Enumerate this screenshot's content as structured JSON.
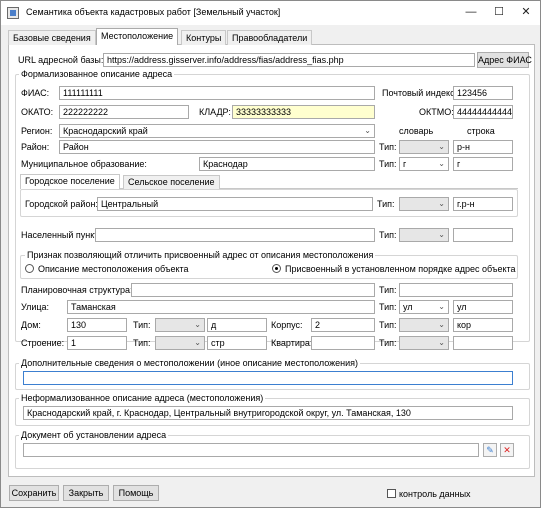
{
  "window": {
    "title": "Семантика объекта кадастровых работ [Земельный участок]",
    "minimize_glyph": "—",
    "maximize_glyph": "☐",
    "close_glyph": "✕"
  },
  "tabs": [
    "Базовые сведения",
    "Местоположение",
    "Контуры",
    "Правообладатели"
  ],
  "url": {
    "label": "URL адресной базы:",
    "value": "https://address.gisserver.info/address/fias/address_fias.php",
    "button": "Адрес ФИАС"
  },
  "formal": {
    "title": "Формализованное описание адреса",
    "fias_label": "ФИАС:",
    "fias": "111111111",
    "postal_label": "Почтовый индекс:",
    "postal": "123456",
    "okato_label": "ОКАТО:",
    "okato": "222222222",
    "kladr_label": "КЛАДР:",
    "kladr": "33333333333",
    "oktmo_label": "ОКТМО:",
    "oktmo": "44444444444",
    "region_label": "Регион:",
    "region": "Краснодарский край",
    "dict_header": "словарь",
    "str_header": "строка",
    "district_label": "Район:",
    "district": "Район",
    "type_label": "Тип:",
    "district_type_str": "р-н",
    "muni_label": "Муниципальное образование:",
    "muni": "Краснодар",
    "muni_type_combo": "г",
    "muni_type_str": "г",
    "subtabs": [
      "Городское поселение",
      "Сельское поселение"
    ],
    "city_district_label": "Городской район:",
    "city_district": "Центральный",
    "city_district_type_str": "г.р-н",
    "locality_label": "Населенный пункт:"
  },
  "sign": {
    "title": "Признак позволяющий отличить присвоенный адрес от описания местоположения",
    "option1": "Описание местоположения объекта",
    "option2": "Присвоенный в установленном порядке адрес объекта"
  },
  "street": {
    "plan_label": "Планировочная структура:",
    "street_label": "Улица:",
    "street": "Таманская",
    "street_type_combo": "ул",
    "street_type_str": "ул",
    "house_label": "Дом:",
    "house": "130",
    "house_type_str": "д",
    "korpus_label": "Корпус:",
    "korpus": "2",
    "korpus_type_str": "кор",
    "building_label": "Строение:",
    "building": "1",
    "building_type_str": "стр",
    "apt_label": "Квартира:"
  },
  "additional": {
    "title": "Дополнительные сведения о местоположении (иное описание местоположения)"
  },
  "nonformal": {
    "title": "Неформализованное описание адреса (местоположения)",
    "value": "Краснодарский край, г. Краснодар, Центральный внутригородской округ, ул. Таманская, 130"
  },
  "document": {
    "title": "Документ об установлении адреса"
  },
  "footer": {
    "save": "Сохранить",
    "close": "Закрыть",
    "help": "Помощь",
    "control": "контроль данных"
  },
  "colors": {
    "accent": "#3c7fd0",
    "kladr_bg": "#ffffcf",
    "delete_icon": "#d22"
  }
}
